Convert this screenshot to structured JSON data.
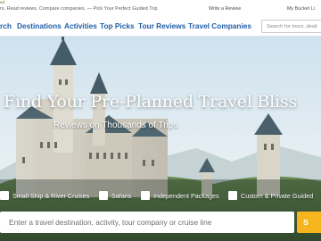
{
  "topbar": {
    "brand_fragment": "ed",
    "tagline": "rs. Read reviews. Compare companies. — Pick Your Perfect Guided Trip",
    "write_review": "Write a Review",
    "bucket_list": "My Bucket Li"
  },
  "nav": {
    "items": [
      "rch",
      "Destinations",
      "Activities",
      "Top Picks",
      "Tour Reviews",
      "Travel Companies"
    ],
    "search_placeholder": "Search for tours, desti"
  },
  "hero": {
    "headline": "Find Your Pre-Planned Travel Bliss",
    "subhead": "Reviews on Thousands of Trips",
    "filters": [
      "Small Ship & River Cruises",
      "Safaris",
      "Independent Packages",
      "Custom & Private Guided"
    ],
    "search_placeholder": "Enter a travel destination, activity, tour company or cruise line",
    "search_button": "S"
  },
  "colors": {
    "nav_link": "#1f5fa8",
    "search_button": "#f6b51e",
    "brand_green": "#7fa85a"
  }
}
